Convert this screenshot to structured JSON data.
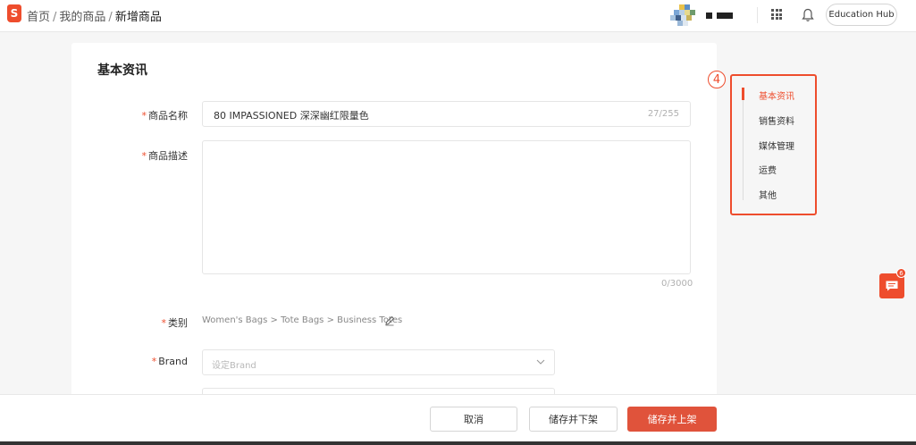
{
  "header": {
    "logo_letter": "S",
    "breadcrumb": [
      "首页",
      "我的商品",
      "新增商品"
    ],
    "separator": "/",
    "education_hub_label": "Education Hub"
  },
  "form": {
    "section_title": "基本资讯",
    "required_mark": "*",
    "name_label": "商品名称",
    "name_value": "80 IMPASSIONED 深深幽红限量色",
    "name_count": "27/255",
    "desc_label": "商品描述",
    "desc_count": "0/3000",
    "category_label": "类别",
    "category_path": "Women's Bags > Tote Bags > Business Totes",
    "brand_label": "Brand",
    "brand_placeholder": "设定Brand"
  },
  "side_nav": {
    "step_number": "4",
    "items": [
      "基本资讯",
      "销售资料",
      "媒体管理",
      "运费",
      "其他"
    ],
    "active_index": 0
  },
  "chat": {
    "badge_count": "6"
  },
  "footer": {
    "cancel_label": "取消",
    "save_unlist_label": "储存并下架",
    "save_publish_label": "储存并上架"
  },
  "colors": {
    "brand": "#ee4d2d",
    "publish_button": "#e0533b"
  }
}
